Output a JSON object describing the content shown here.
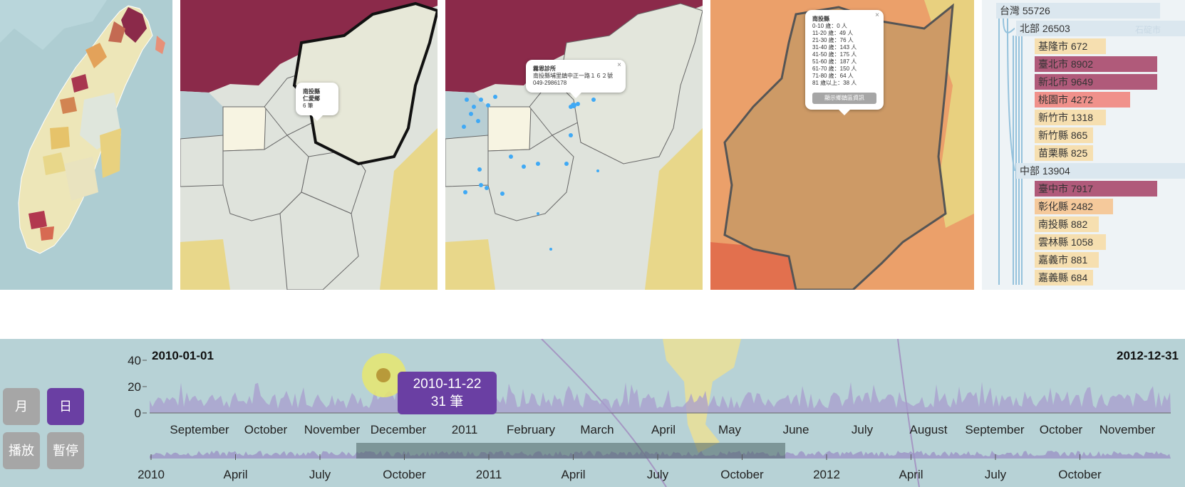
{
  "colors": {
    "accent_purple": "#6a3fa3",
    "button_gray": "#a6a6a6",
    "map_dark_red": "#8b2a4a",
    "bar_dark": "#b05a7a",
    "bar_salmon": "#f0918b",
    "bar_peach": "#f5c99b",
    "bar_light": "#f6dfb0",
    "water": "#b7d2d6"
  },
  "map2_popup": {
    "county": "南投縣",
    "township": "仁愛鄉",
    "count": "6 筆"
  },
  "map3_popup": {
    "name": "霧恩診所",
    "address": "南投縣埔里鎮中正一路１６２號",
    "phone": "049-2986178",
    "close_icon": "close-icon"
  },
  "map4_popup": {
    "county": "南投縣",
    "rows": [
      "0-10 歲：0 人",
      "11-20 歲：49 人",
      "21-30 歲：76 人",
      "31-40 歲：143 人",
      "41-50 歲：175 人",
      "51-60 歲：187 人",
      "61-70 歲：150 人",
      "71-80 歲：64 人",
      "81 歲以上：38 人"
    ],
    "button_label": "顯示鄉鎮區資訊"
  },
  "tree": {
    "root": "台灣 55726",
    "north": "北部 26503",
    "north_items": [
      "基隆市 672",
      "臺北市 8902",
      "新北市 9649",
      "桃園市 4272",
      "新竹市 1318",
      "新竹縣 865",
      "苗栗縣 825"
    ],
    "central": "中部 13904",
    "central_items": [
      "臺中市 7917",
      "彰化縣 2482",
      "南投縣 882",
      "雲林縣 1058",
      "嘉義市 881",
      "嘉義縣 684"
    ],
    "faded_label": "石碇市"
  },
  "controls": {
    "month_label": "月",
    "day_label": "日",
    "play_label": "播放",
    "pause_label": "暫停"
  },
  "timeline": {
    "start_date": "2010-01-01",
    "end_date": "2012-12-31",
    "y_ticks": [
      "40",
      "20",
      "0"
    ],
    "ymax": 40,
    "detail_ticks": [
      "September",
      "October",
      "November",
      "December",
      "2011",
      "February",
      "March",
      "April",
      "May",
      "June",
      "July",
      "August",
      "September",
      "October",
      "November"
    ],
    "overview_ticks": [
      "2010",
      "April",
      "July",
      "October",
      "2011",
      "April",
      "July",
      "October",
      "2012",
      "April",
      "July",
      "October"
    ],
    "tooltip_date": "2010-11-22",
    "tooltip_count": "31 筆"
  }
}
